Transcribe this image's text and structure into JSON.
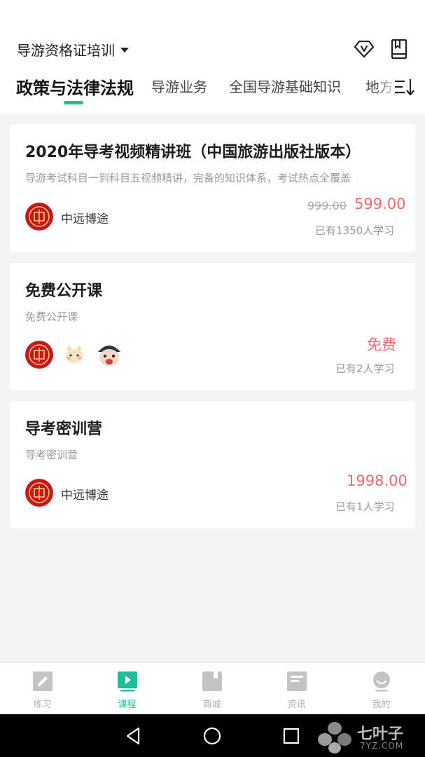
{
  "header": {
    "course_selector": "导游资格证培训",
    "icons": [
      "vip-icon",
      "book-icon"
    ]
  },
  "tabs": [
    {
      "label": "政策与法律法规",
      "active": true
    },
    {
      "label": "导游业务",
      "active": false
    },
    {
      "label": "全国导游基础知识",
      "active": false
    },
    {
      "label": "地方",
      "active": false
    }
  ],
  "courses": [
    {
      "title": "2020年导考视频精讲班（中国旅游出版社版本）",
      "description": "导游考试科目一到科目五视频精讲，完备的知识体系，考试热点全覆盖",
      "teacher": "中远博途",
      "old_price": "999.00",
      "price": "599.00",
      "learners": "已有1350人学习"
    },
    {
      "title": "免费公开课",
      "description": "免费公开课",
      "price": "免费",
      "learners": "已有2人学习"
    },
    {
      "title": "导考密训营",
      "description": "导考密训营",
      "teacher": "中远博途",
      "price": "1998.00",
      "learners": "已有1人学习"
    }
  ],
  "bottom_nav": [
    {
      "label": "练习",
      "icon": "pencil-icon",
      "active": false
    },
    {
      "label": "课程",
      "icon": "play-icon",
      "active": true
    },
    {
      "label": "商城",
      "icon": "bookmark-icon",
      "active": false
    },
    {
      "label": "资讯",
      "icon": "news-icon",
      "active": false
    },
    {
      "label": "我的",
      "icon": "profile-icon",
      "active": false
    }
  ],
  "watermark": {
    "name": "七叶子",
    "domain": "7YZ.COM"
  },
  "colors": {
    "accent": "#1dbf99",
    "price": "#f06a6a",
    "background": "#f4f4f4"
  }
}
